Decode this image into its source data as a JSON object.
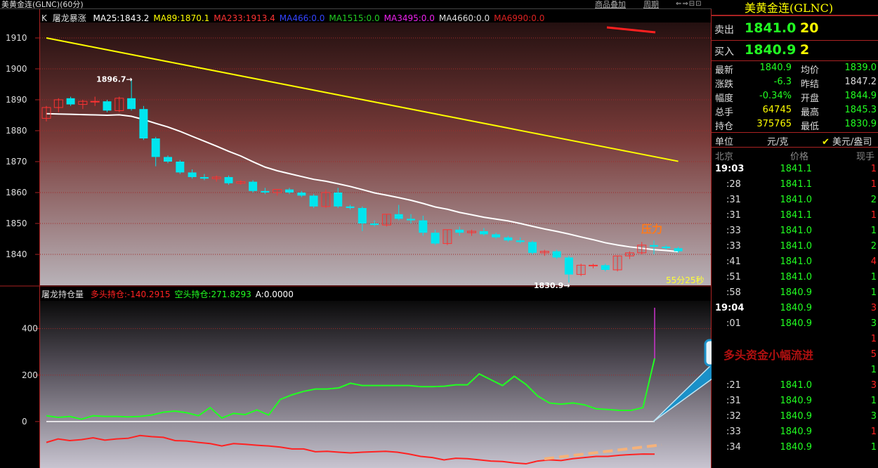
{
  "window_title": "美黄金连(GLNC)(60分)",
  "top_links": [
    "商品叠加",
    "周期"
  ],
  "main_legend": {
    "prefix": "K",
    "name": "屠龙暴涨",
    "items": [
      {
        "text": "MA25:1843.2",
        "color": "#ffffff"
      },
      {
        "text": "MA89:1870.1",
        "color": "#ffff00"
      },
      {
        "text": "MA233:1913.4",
        "color": "#ff3333"
      },
      {
        "text": "MA466:0.0",
        "color": "#3344ff"
      },
      {
        "text": "MA1515:0.0",
        "color": "#22cc22"
      },
      {
        "text": "MA3495:0.0",
        "color": "#ee22ee"
      },
      {
        "text": "MA4660:0.0",
        "color": "#dddddd"
      },
      {
        "text": "MA6990:0.0",
        "color": "#dd2222"
      }
    ]
  },
  "sub_legend": {
    "name": "屠龙持仓量",
    "items": [
      {
        "text": "多头持仓:-140.2915",
        "color": "#ff2222"
      },
      {
        "text": "空头持仓:271.8293",
        "color": "#22ff22"
      },
      {
        "text": "A:0.0000",
        "color": "#ffffff"
      }
    ]
  },
  "countdown": "55分25秒",
  "annotation_pressure": "压力",
  "annotation_callout": "多头资金小幅流进",
  "chart_data": [
    {
      "type": "candlestick",
      "ylim": [
        1830,
        1915
      ],
      "yticks": [
        1840,
        1850,
        1860,
        1870,
        1880,
        1890,
        1900,
        1910
      ],
      "ohlc": [
        [
          1884.0,
          1888.0,
          1883.0,
          1887.5
        ],
        [
          1887.5,
          1890.5,
          1886.0,
          1890.0
        ],
        [
          1890.5,
          1891.0,
          1888.0,
          1888.5
        ],
        [
          1888.5,
          1890.0,
          1887.0,
          1889.5
        ],
        [
          1889.5,
          1891.0,
          1888.0,
          1889.5
        ],
        [
          1889.5,
          1890.0,
          1886.0,
          1886.5
        ],
        [
          1886.5,
          1891.0,
          1886.0,
          1890.5
        ],
        [
          1890.5,
          1896.7,
          1886.5,
          1887.0
        ],
        [
          1887.0,
          1888.0,
          1877.0,
          1877.5
        ],
        [
          1877.5,
          1878.0,
          1868.5,
          1871.5
        ],
        [
          1871.5,
          1872.0,
          1869.5,
          1870.0
        ],
        [
          1870.0,
          1870.5,
          1866.0,
          1866.5
        ],
        [
          1866.5,
          1867.5,
          1864.5,
          1865.0
        ],
        [
          1865.0,
          1866.0,
          1864.0,
          1864.5
        ],
        [
          1864.5,
          1865.5,
          1863.5,
          1865.0
        ],
        [
          1865.0,
          1865.5,
          1862.5,
          1863.0
        ],
        [
          1863.0,
          1864.0,
          1862.5,
          1863.5
        ],
        [
          1863.5,
          1864.0,
          1860.0,
          1860.5
        ],
        [
          1860.5,
          1861.5,
          1859.5,
          1860.0
        ],
        [
          1860.0,
          1861.0,
          1859.0,
          1861.0
        ],
        [
          1861.0,
          1861.5,
          1859.5,
          1860.0
        ],
        [
          1860.0,
          1860.5,
          1858.5,
          1859.0
        ],
        [
          1859.0,
          1859.5,
          1855.0,
          1855.5
        ],
        [
          1855.5,
          1861.0,
          1855.0,
          1860.0
        ],
        [
          1860.0,
          1861.5,
          1855.0,
          1855.5
        ],
        [
          1855.5,
          1856.0,
          1854.5,
          1855.0
        ],
        [
          1855.0,
          1855.5,
          1847.5,
          1850.0
        ],
        [
          1850.0,
          1851.0,
          1849.0,
          1849.5
        ],
        [
          1849.5,
          1853.0,
          1849.0,
          1853.0
        ],
        [
          1853.0,
          1856.0,
          1851.0,
          1851.5
        ],
        [
          1851.5,
          1853.0,
          1850.0,
          1851.0
        ],
        [
          1851.0,
          1852.5,
          1846.0,
          1847.0
        ],
        [
          1847.0,
          1848.0,
          1843.0,
          1843.5
        ],
        [
          1843.5,
          1848.0,
          1843.0,
          1848.0
        ],
        [
          1848.0,
          1849.0,
          1846.0,
          1847.0
        ],
        [
          1847.0,
          1848.0,
          1846.0,
          1847.5
        ],
        [
          1847.5,
          1848.5,
          1846.0,
          1846.5
        ],
        [
          1846.5,
          1847.0,
          1845.0,
          1845.5
        ],
        [
          1845.5,
          1846.0,
          1844.0,
          1844.5
        ],
        [
          1844.5,
          1845.5,
          1843.5,
          1844.0
        ],
        [
          1844.0,
          1844.5,
          1840.0,
          1840.5
        ],
        [
          1840.5,
          1841.5,
          1839.5,
          1841.0
        ],
        [
          1841.0,
          1841.5,
          1838.5,
          1839.0
        ],
        [
          1839.0,
          1839.5,
          1830.9,
          1833.5
        ],
        [
          1833.5,
          1837.0,
          1833.0,
          1836.5
        ],
        [
          1836.5,
          1837.0,
          1835.5,
          1836.5
        ],
        [
          1836.5,
          1837.0,
          1834.5,
          1835.0
        ],
        [
          1835.0,
          1839.5,
          1834.5,
          1839.5
        ],
        [
          1839.5,
          1841.0,
          1838.5,
          1840.5
        ],
        [
          1840.5,
          1844.0,
          1840.0,
          1843.0
        ],
        [
          1843.0,
          1844.5,
          1840.0,
          1842.5
        ],
        [
          1842.5,
          1843.0,
          1841.5,
          1842.0
        ],
        [
          1842.0,
          1842.5,
          1840.5,
          1841.0
        ]
      ],
      "series": [
        {
          "name": "MA89",
          "color": "#ffff00",
          "values_start_end": [
            1910,
            1870.1
          ]
        },
        {
          "name": "MA25",
          "color": "#ffffff",
          "values_start_end": [
            1885.5,
            1843.2
          ]
        },
        {
          "name": "MA233",
          "color": "#ff2222",
          "values_start_end": [
            1913.2,
            1913.4
          ]
        }
      ],
      "annotations": [
        {
          "text": "1896.7",
          "value": 1896.7
        },
        {
          "text": "1830.9",
          "value": 1830.9
        }
      ]
    },
    {
      "type": "line",
      "ylim": [
        -200,
        520
      ],
      "yticks": [
        0,
        200,
        400
      ],
      "series": [
        {
          "name": "空头持仓",
          "color": "#22ff22",
          "values": [
            25,
            18,
            22,
            10,
            25,
            22,
            22,
            20,
            22,
            28,
            40,
            45,
            38,
            25,
            60,
            15,
            35,
            30,
            50,
            28,
            95,
            115,
            130,
            140,
            140,
            145,
            165,
            155,
            155,
            155,
            155,
            155,
            150,
            150,
            152,
            158,
            158,
            205,
            180,
            155,
            195,
            160,
            110,
            80,
            75,
            80,
            72,
            55,
            52,
            48,
            48,
            60,
            271.8
          ]
        },
        {
          "name": "多头持仓",
          "color": "#ff2222",
          "values": [
            -90,
            -75,
            -82,
            -78,
            -70,
            -80,
            -75,
            -72,
            -60,
            -65,
            -68,
            -82,
            -84,
            -90,
            -95,
            -105,
            -95,
            -98,
            -102,
            -105,
            -110,
            -118,
            -118,
            -130,
            -128,
            -132,
            -135,
            -132,
            -130,
            -128,
            -132,
            -140,
            -150,
            -155,
            -165,
            -158,
            -160,
            -165,
            -170,
            -172,
            -178,
            -182,
            -170,
            -165,
            -168,
            -160,
            -155,
            -150,
            -150,
            -145,
            -142,
            -140,
            -140.3
          ]
        }
      ]
    }
  ],
  "quote": {
    "title": "美黄金连(GLNC)",
    "sell_label": "卖出",
    "sell_price": "1841.0",
    "sell_qty": "20",
    "buy_label": "买入",
    "buy_price": "1840.9",
    "buy_qty": "2",
    "stats": [
      {
        "l1": "最新",
        "v1": "1840.9",
        "c1": "#22ff22",
        "l2": "均价",
        "v2": "1839.0",
        "c2": "#22ff22"
      },
      {
        "l1": "涨跌",
        "v1": "-6.3",
        "c1": "#22ff22",
        "l2": "昨结",
        "v2": "1847.2",
        "c2": "#dddddd"
      },
      {
        "l1": "幅度",
        "v1": "-0.34%",
        "c1": "#22ff22",
        "l2": "开盘",
        "v2": "1844.9",
        "c2": "#22ff22"
      },
      {
        "l1": "总手",
        "v1": "64745",
        "c1": "#ffff00",
        "l2": "最高",
        "v2": "1845.3",
        "c2": "#22ff22"
      },
      {
        "l1": "持仓",
        "v1": "375765",
        "c1": "#ffff00",
        "l2": "最低",
        "v2": "1830.9",
        "c2": "#22ff22"
      }
    ],
    "unit_label": "单位",
    "unit_value": "元/克",
    "unit_alt": "美元/盎司",
    "ticks_header": [
      "北京",
      "价格",
      "现手"
    ],
    "ticks": [
      {
        "time": "19:03",
        "price": "1841.1",
        "qty": "1",
        "qc": "#ff2222",
        "bold": true
      },
      {
        "time": ":28",
        "price": "1841.1",
        "qty": "1",
        "qc": "#ff2222"
      },
      {
        "time": ":31",
        "price": "1841.0",
        "qty": "2",
        "qc": "#22ff22"
      },
      {
        "time": ":31",
        "price": "1841.1",
        "qty": "1",
        "qc": "#ff2222"
      },
      {
        "time": ":33",
        "price": "1841.0",
        "qty": "1",
        "qc": "#22ff22"
      },
      {
        "time": ":33",
        "price": "1841.0",
        "qty": "2",
        "qc": "#22ff22"
      },
      {
        "time": ":41",
        "price": "1841.0",
        "qty": "4",
        "qc": "#ff2222"
      },
      {
        "time": ":51",
        "price": "1841.0",
        "qty": "1",
        "qc": "#22ff22"
      },
      {
        "time": ":58",
        "price": "1840.9",
        "qty": "1",
        "qc": "#22ff22"
      },
      {
        "time": "19:04",
        "price": "1840.9",
        "qty": "3",
        "qc": "#ff2222",
        "bold": true
      },
      {
        "time": ":01",
        "price": "1840.9",
        "qty": "3",
        "qc": "#22ff22"
      },
      {
        "time": "",
        "price": "",
        "qty": "1",
        "qc": "#ff2222"
      },
      {
        "time": "",
        "price": "",
        "qty": "5",
        "qc": "#ff2222"
      },
      {
        "time": "",
        "price": "",
        "qty": "1",
        "qc": "#22ff22"
      },
      {
        "time": ":21",
        "price": "1841.0",
        "qty": "3",
        "qc": "#ff2222"
      },
      {
        "time": ":31",
        "price": "1840.9",
        "qty": "1",
        "qc": "#22ff22"
      },
      {
        "time": ":32",
        "price": "1840.9",
        "qty": "3",
        "qc": "#22ff22"
      },
      {
        "time": ":33",
        "price": "1840.9",
        "qty": "1",
        "qc": "#ff2222"
      },
      {
        "time": ":34",
        "price": "1840.9",
        "qty": "1",
        "qc": "#22ff22"
      }
    ]
  }
}
